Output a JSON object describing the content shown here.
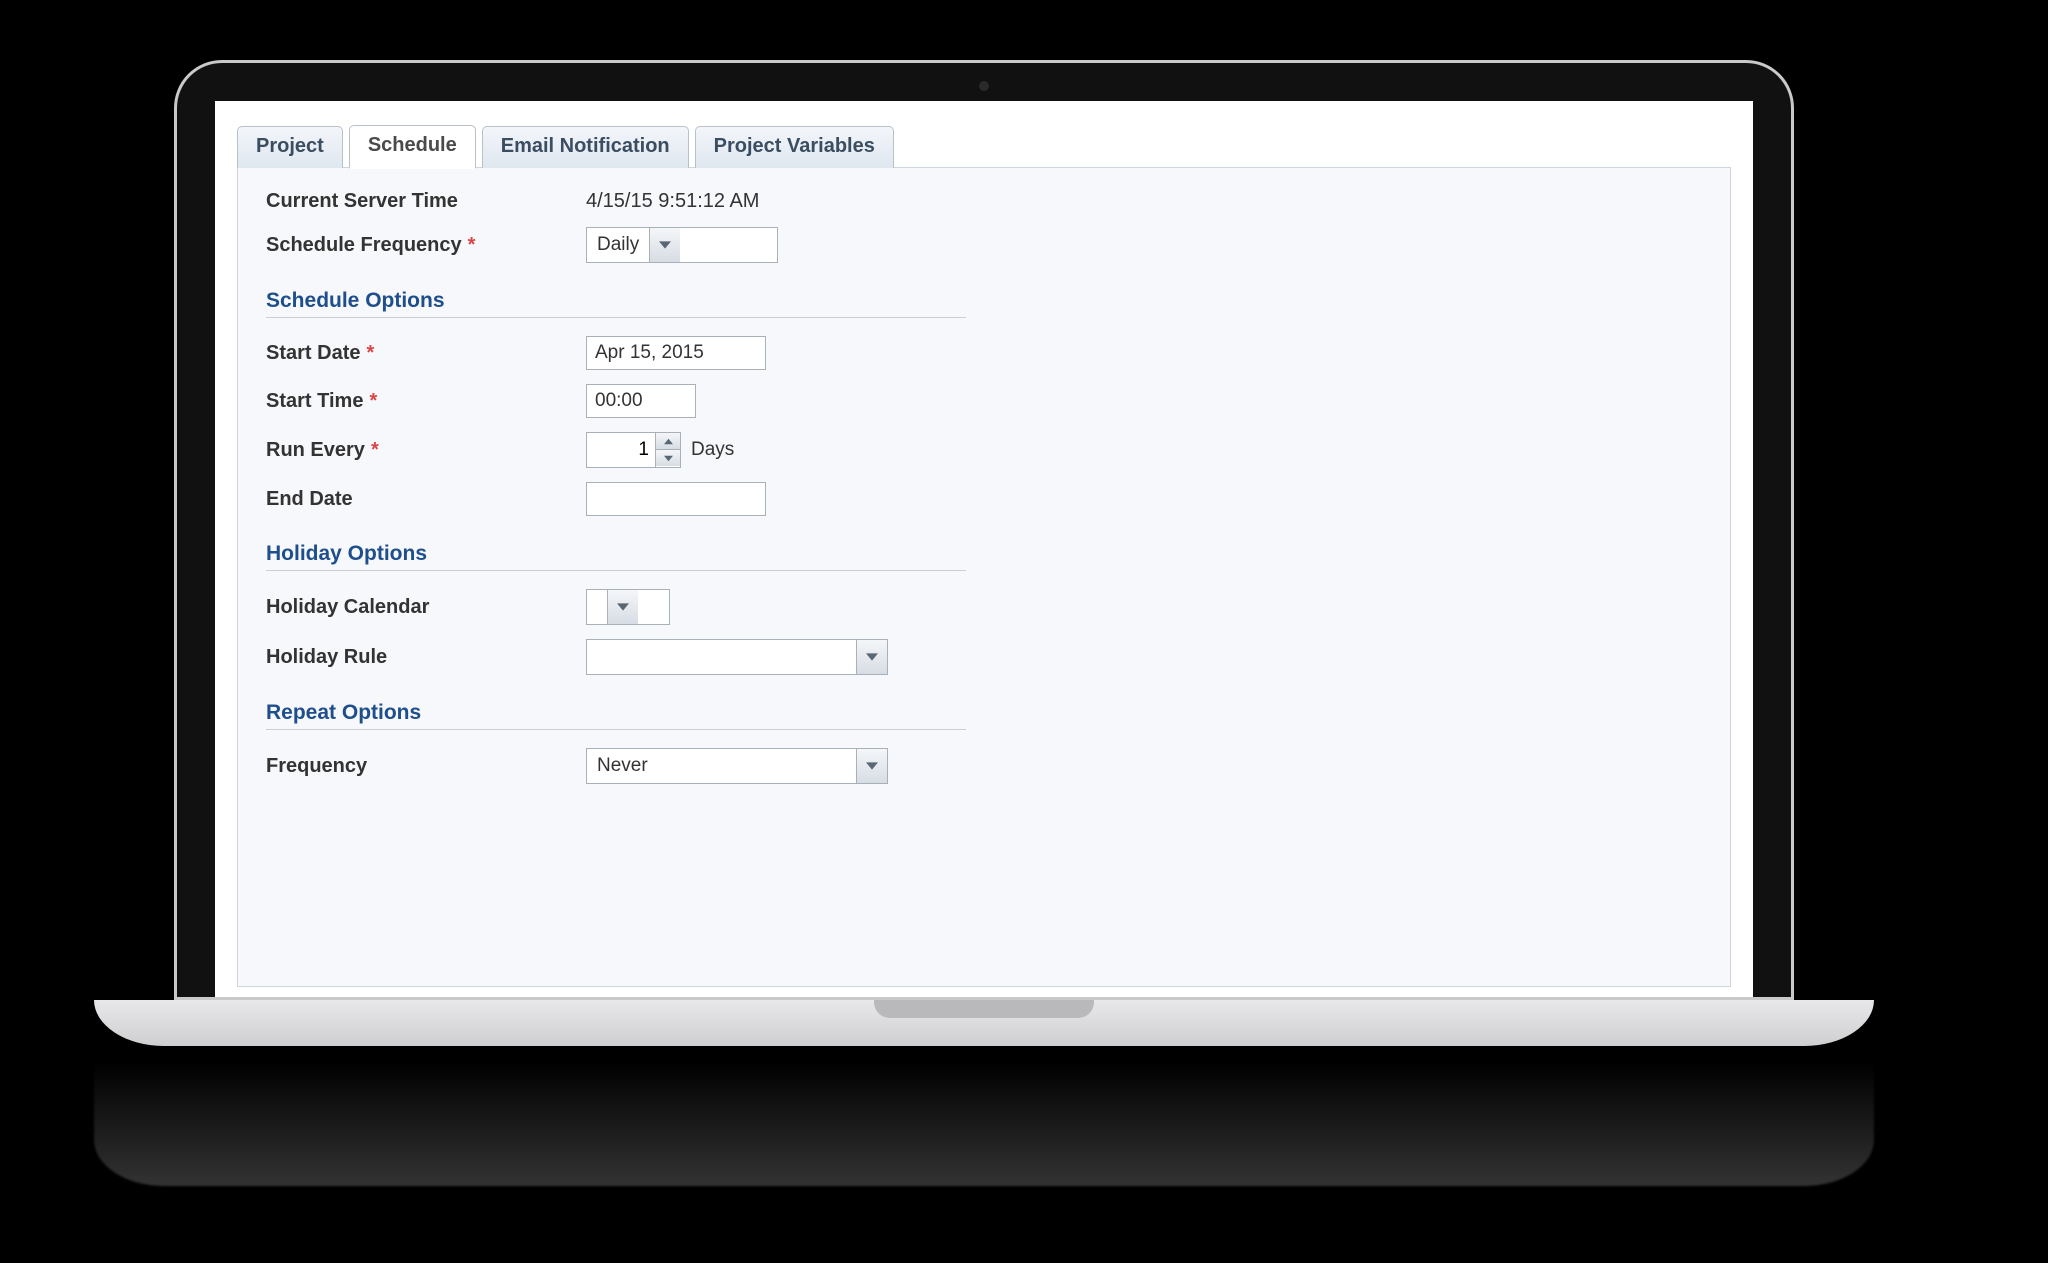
{
  "tabs": [
    {
      "label": "Project"
    },
    {
      "label": "Schedule"
    },
    {
      "label": "Email Notification"
    },
    {
      "label": "Project Variables"
    }
  ],
  "active_tab_index": 1,
  "header": {
    "server_time_label": "Current Server Time",
    "server_time_value": "4/15/15 9:51:12 AM",
    "frequency_label": "Schedule Frequency",
    "frequency_value": "Daily"
  },
  "schedule": {
    "section_title": "Schedule Options",
    "start_date_label": "Start Date",
    "start_date_value": "Apr 15, 2015",
    "start_time_label": "Start Time",
    "start_time_value": "00:00",
    "run_every_label": "Run Every",
    "run_every_value": "1",
    "run_every_unit": "Days",
    "end_date_label": "End Date",
    "end_date_value": ""
  },
  "holiday": {
    "section_title": "Holiday Options",
    "calendar_label": "Holiday Calendar",
    "calendar_value": "",
    "rule_label": "Holiday Rule",
    "rule_value": ""
  },
  "repeat": {
    "section_title": "Repeat Options",
    "frequency_label": "Frequency",
    "frequency_value": "Never"
  }
}
